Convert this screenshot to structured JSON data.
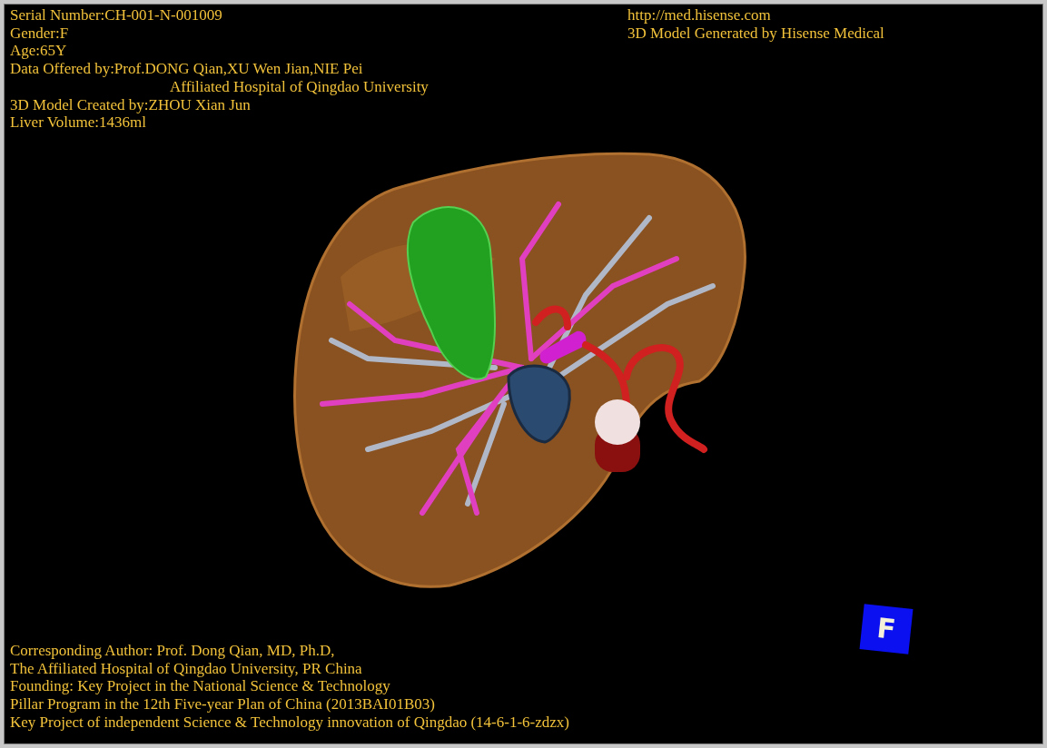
{
  "patient_info": [
    {
      "text": "Serial Number:CH-001-N-001009"
    },
    {
      "text": "Gender:F"
    },
    {
      "text": "Age:65Y"
    },
    {
      "text": "Data Offered by:Prof.DONG Qian,XU Wen Jian,NIE Pei",
      "children": [
        {
          "text": "Affiliated Hospital of Qingdao University"
        }
      ]
    },
    {
      "text": "3D Model Created by:ZHOU Xian Jun"
    },
    {
      "text": "Liver Volume:1436ml"
    }
  ],
  "generator_info": [
    "http://med.hisense.com",
    "3D Model Generated by Hisense Medical"
  ],
  "orientation_marker": {
    "label": "F"
  },
  "credits": [
    "Corresponding Author: Prof. Dong Qian, MD, Ph.D,",
    "The Affiliated Hospital of Qingdao University, PR China",
    "Founding: Key Project in the National Science & Technology",
    "Pillar Program in the 12th Five-year Plan of China (2013BAI01B03)",
    "Key Project of independent Science & Technology innovation of Qingdao (14-6-1-6-zdzx)"
  ]
}
